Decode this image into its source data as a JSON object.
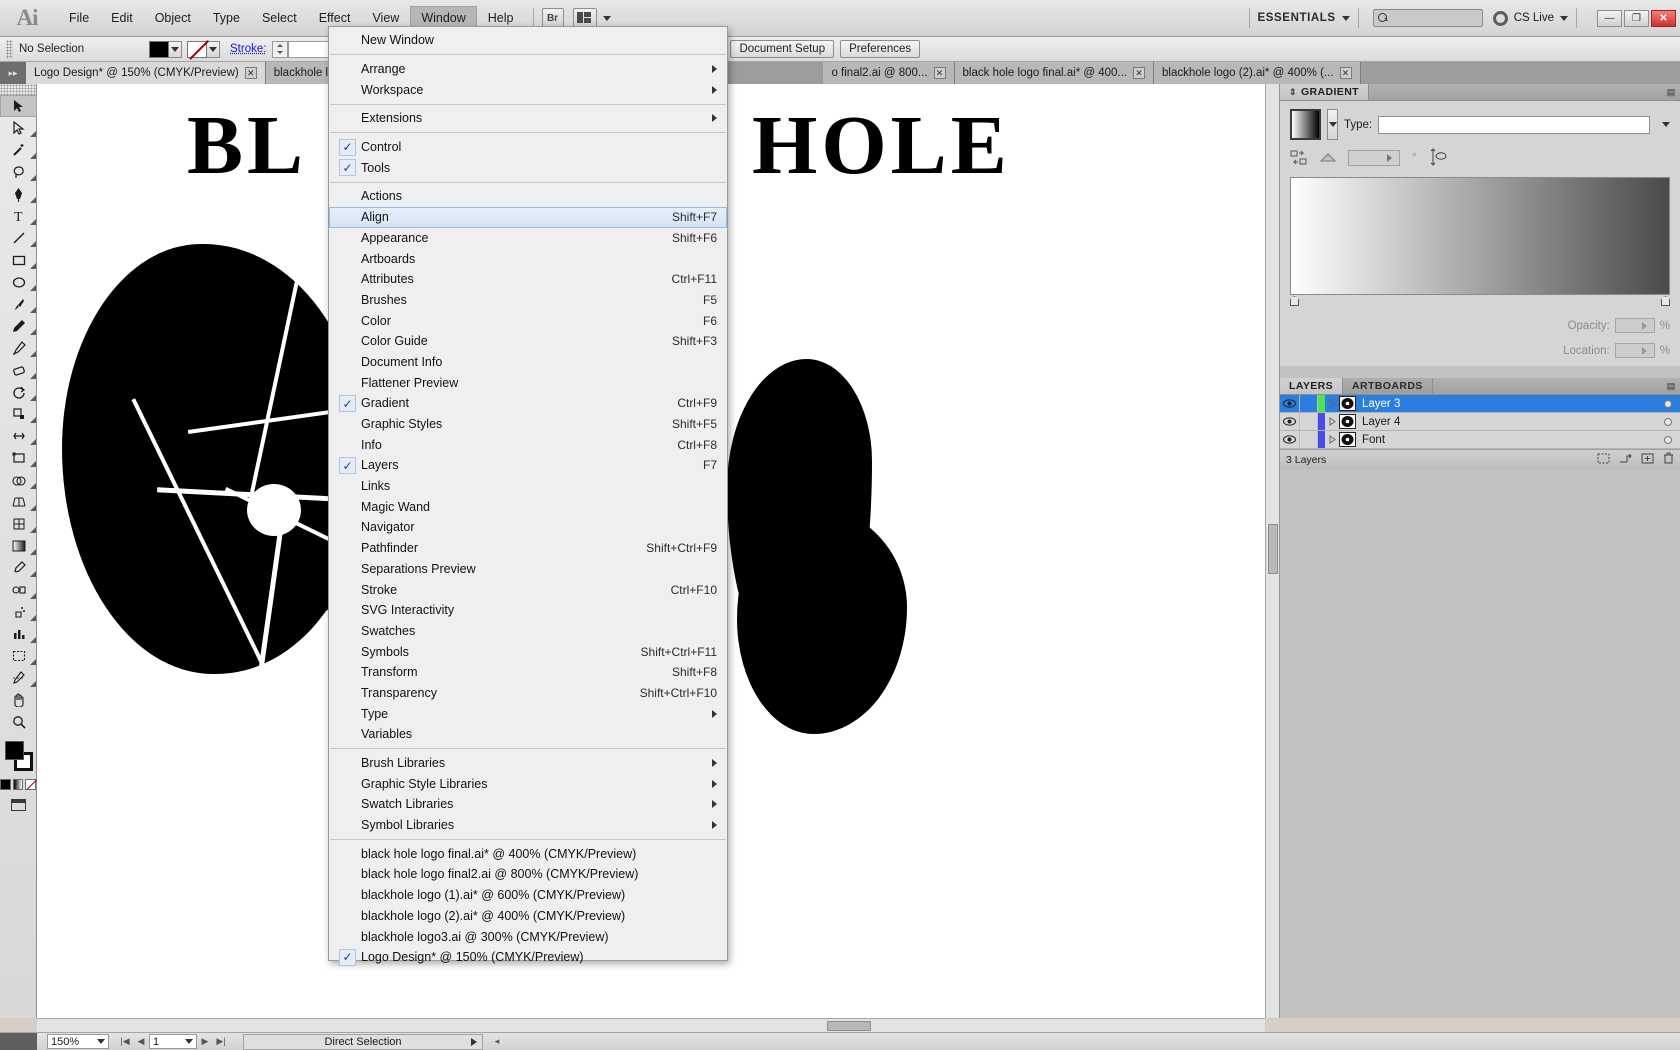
{
  "app": {
    "logo": "Ai"
  },
  "menubar": {
    "items": [
      "File",
      "Edit",
      "Object",
      "Type",
      "Select",
      "Effect",
      "View",
      "Window",
      "Help"
    ],
    "active": "Window",
    "bridge_label": "Br",
    "workspace_label": "ESSENTIALS",
    "search_placeholder": "",
    "cslive_label": "CS Live",
    "window_buttons": [
      "—",
      "❐",
      "✕"
    ]
  },
  "controlbar": {
    "selection_status": "No Selection",
    "stroke_label": "Stroke:",
    "stroke_value": "",
    "opacity_value": "",
    "buttons": [
      "Document Setup",
      "Preferences"
    ]
  },
  "tabs": [
    {
      "title": "Logo Design* @ 150% (CMYK/Preview)",
      "active": true,
      "close": "✕"
    },
    {
      "title": "blackhole lo",
      "active": false,
      "close": ""
    },
    {
      "title": "o final2.ai @ 800...",
      "active": false,
      "close": "✕"
    },
    {
      "title": "black hole logo final.ai* @ 400...",
      "active": false,
      "close": "✕"
    },
    {
      "title": "blackhole logo (2).ai* @ 400% (...",
      "active": false,
      "close": "✕"
    }
  ],
  "toolbox": {
    "tools": [
      "selection-tool",
      "direct-selection-tool",
      "magic-wand-tool",
      "lasso-tool",
      "pen-tool",
      "type-tool",
      "line-segment-tool",
      "rectangle-tool",
      "paintbrush-tool",
      "pencil-tool",
      "blob-brush-tool",
      "eraser-tool",
      "rotate-tool",
      "scale-tool",
      "width-tool",
      "free-transform-tool",
      "shape-builder-tool",
      "perspective-grid-tool",
      "mesh-tool",
      "gradient-tool",
      "eyedropper-tool",
      "blend-tool",
      "symbol-sprayer-tool",
      "column-graph-tool",
      "artboard-tool",
      "slice-tool",
      "hand-tool",
      "zoom-tool"
    ]
  },
  "canvas": {
    "headline_left": "BL",
    "headline_right": "HOLE"
  },
  "menu": {
    "title": "Window",
    "groups": [
      {
        "items": [
          {
            "label": "New Window",
            "shortcut": "",
            "checked": false,
            "submenu": false
          }
        ]
      },
      {
        "items": [
          {
            "label": "Arrange",
            "shortcut": "",
            "checked": false,
            "submenu": true
          },
          {
            "label": "Workspace",
            "shortcut": "",
            "checked": false,
            "submenu": true
          }
        ]
      },
      {
        "items": [
          {
            "label": "Extensions",
            "shortcut": "",
            "checked": false,
            "submenu": true
          }
        ]
      },
      {
        "items": [
          {
            "label": "Control",
            "shortcut": "",
            "checked": true,
            "submenu": false
          },
          {
            "label": "Tools",
            "shortcut": "",
            "checked": true,
            "submenu": false
          }
        ]
      },
      {
        "items": [
          {
            "label": "Actions",
            "shortcut": "",
            "checked": false,
            "submenu": false
          },
          {
            "label": "Align",
            "shortcut": "Shift+F7",
            "checked": false,
            "submenu": false,
            "highlighted": true
          },
          {
            "label": "Appearance",
            "shortcut": "Shift+F6",
            "checked": false,
            "submenu": false
          },
          {
            "label": "Artboards",
            "shortcut": "",
            "checked": false,
            "submenu": false
          },
          {
            "label": "Attributes",
            "shortcut": "Ctrl+F11",
            "checked": false,
            "submenu": false
          },
          {
            "label": "Brushes",
            "shortcut": "F5",
            "checked": false,
            "submenu": false
          },
          {
            "label": "Color",
            "shortcut": "F6",
            "checked": false,
            "submenu": false
          },
          {
            "label": "Color Guide",
            "shortcut": "Shift+F3",
            "checked": false,
            "submenu": false
          },
          {
            "label": "Document Info",
            "shortcut": "",
            "checked": false,
            "submenu": false
          },
          {
            "label": "Flattener Preview",
            "shortcut": "",
            "checked": false,
            "submenu": false
          },
          {
            "label": "Gradient",
            "shortcut": "Ctrl+F9",
            "checked": true,
            "submenu": false
          },
          {
            "label": "Graphic Styles",
            "shortcut": "Shift+F5",
            "checked": false,
            "submenu": false
          },
          {
            "label": "Info",
            "shortcut": "Ctrl+F8",
            "checked": false,
            "submenu": false
          },
          {
            "label": "Layers",
            "shortcut": "F7",
            "checked": true,
            "submenu": false
          },
          {
            "label": "Links",
            "shortcut": "",
            "checked": false,
            "submenu": false
          },
          {
            "label": "Magic Wand",
            "shortcut": "",
            "checked": false,
            "submenu": false
          },
          {
            "label": "Navigator",
            "shortcut": "",
            "checked": false,
            "submenu": false
          },
          {
            "label": "Pathfinder",
            "shortcut": "Shift+Ctrl+F9",
            "checked": false,
            "submenu": false
          },
          {
            "label": "Separations Preview",
            "shortcut": "",
            "checked": false,
            "submenu": false
          },
          {
            "label": "Stroke",
            "shortcut": "Ctrl+F10",
            "checked": false,
            "submenu": false
          },
          {
            "label": "SVG Interactivity",
            "shortcut": "",
            "checked": false,
            "submenu": false
          },
          {
            "label": "Swatches",
            "shortcut": "",
            "checked": false,
            "submenu": false
          },
          {
            "label": "Symbols",
            "shortcut": "Shift+Ctrl+F11",
            "checked": false,
            "submenu": false
          },
          {
            "label": "Transform",
            "shortcut": "Shift+F8",
            "checked": false,
            "submenu": false
          },
          {
            "label": "Transparency",
            "shortcut": "Shift+Ctrl+F10",
            "checked": false,
            "submenu": false
          },
          {
            "label": "Type",
            "shortcut": "",
            "checked": false,
            "submenu": true
          },
          {
            "label": "Variables",
            "shortcut": "",
            "checked": false,
            "submenu": false
          }
        ]
      },
      {
        "items": [
          {
            "label": "Brush Libraries",
            "shortcut": "",
            "checked": false,
            "submenu": true
          },
          {
            "label": "Graphic Style Libraries",
            "shortcut": "",
            "checked": false,
            "submenu": true
          },
          {
            "label": "Swatch Libraries",
            "shortcut": "",
            "checked": false,
            "submenu": true
          },
          {
            "label": "Symbol Libraries",
            "shortcut": "",
            "checked": false,
            "submenu": true
          }
        ]
      },
      {
        "items": [
          {
            "label": "black hole logo final.ai* @ 400% (CMYK/Preview)",
            "shortcut": "",
            "checked": false,
            "submenu": false
          },
          {
            "label": "black hole logo final2.ai @ 800% (CMYK/Preview)",
            "shortcut": "",
            "checked": false,
            "submenu": false
          },
          {
            "label": "blackhole logo (1).ai* @ 600% (CMYK/Preview)",
            "shortcut": "",
            "checked": false,
            "submenu": false
          },
          {
            "label": "blackhole logo (2).ai* @ 400% (CMYK/Preview)",
            "shortcut": "",
            "checked": false,
            "submenu": false
          },
          {
            "label": "blackhole logo3.ai @ 300% (CMYK/Preview)",
            "shortcut": "",
            "checked": false,
            "submenu": false
          },
          {
            "label": "Logo Design* @ 150% (CMYK/Preview)",
            "shortcut": "",
            "checked": true,
            "submenu": false
          }
        ]
      }
    ]
  },
  "gradient_panel": {
    "tab_label": "GRADIENT",
    "type_label": "Type:",
    "type_value": "",
    "angle_value": "",
    "angle_unit": "°",
    "opacity_label": "Opacity:",
    "opacity_value": "",
    "opacity_unit": "%",
    "location_label": "Location:",
    "location_value": "",
    "location_unit": "%",
    "percent_unit": "%"
  },
  "layers_panel": {
    "tabs": [
      "LAYERS",
      "ARTBOARDS"
    ],
    "active_tab": "LAYERS",
    "rows": [
      {
        "name": "Layer 3",
        "selected": true,
        "color": "#4ce64c",
        "visible": true
      },
      {
        "name": "Layer 4",
        "selected": false,
        "color": "#4a4ae6",
        "visible": true
      },
      {
        "name": "Font",
        "selected": false,
        "color": "#4a4ae6",
        "visible": true
      }
    ],
    "footer_count": "3 Layers"
  },
  "statusbar": {
    "zoom": "150%",
    "page": "1",
    "tool_status": "Direct Selection"
  }
}
